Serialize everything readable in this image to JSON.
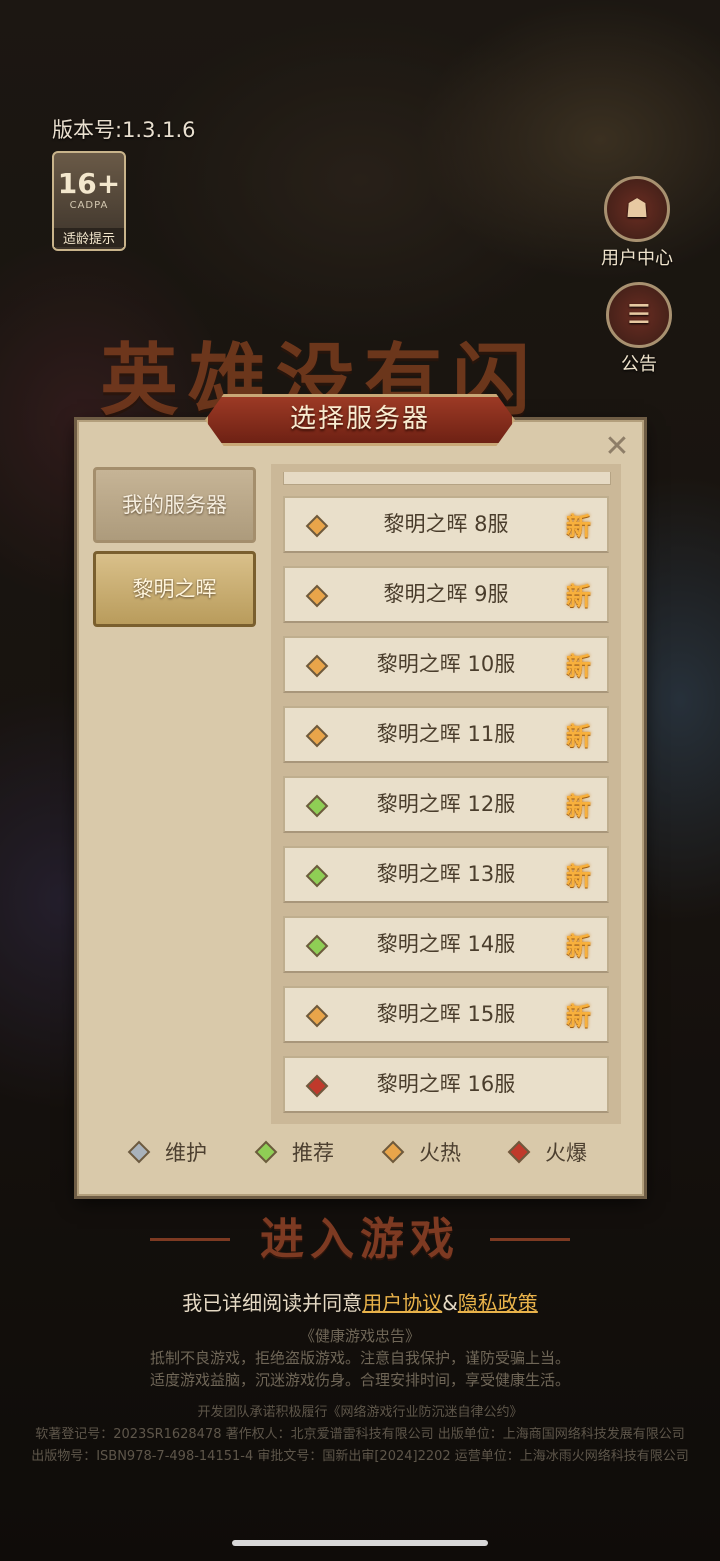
{
  "header": {
    "version_label": "版本号:1.3.1.6",
    "age_rating": {
      "badge": "16+",
      "org": "CADPA",
      "tip": "适龄提示"
    }
  },
  "side_buttons": {
    "user_center": "用户中心",
    "notice": "公告"
  },
  "game_logo_text": "英雄没有闪",
  "server_dialog": {
    "title": "选择服务器",
    "close_glyph": "✕",
    "tabs": [
      {
        "label": "我的服务器",
        "active": false
      },
      {
        "label": "黎明之晖",
        "active": true
      }
    ],
    "servers": [
      {
        "name": "黎明之晖 8服",
        "status": "hot",
        "new_badge": "新"
      },
      {
        "name": "黎明之晖 9服",
        "status": "hot",
        "new_badge": "新"
      },
      {
        "name": "黎明之晖 10服",
        "status": "hot",
        "new_badge": "新"
      },
      {
        "name": "黎明之晖 11服",
        "status": "hot",
        "new_badge": "新"
      },
      {
        "name": "黎明之晖 12服",
        "status": "recommend",
        "new_badge": "新"
      },
      {
        "name": "黎明之晖 13服",
        "status": "recommend",
        "new_badge": "新"
      },
      {
        "name": "黎明之晖 14服",
        "status": "recommend",
        "new_badge": "新"
      },
      {
        "name": "黎明之晖 15服",
        "status": "hot",
        "new_badge": "新"
      },
      {
        "name": "黎明之晖 16服",
        "status": "fire",
        "new_badge": ""
      }
    ],
    "legend": [
      {
        "key": "maintenance",
        "label": "维护"
      },
      {
        "key": "recommend",
        "label": "推荐"
      },
      {
        "key": "hot",
        "label": "火热"
      },
      {
        "key": "fire",
        "label": "火爆"
      }
    ]
  },
  "status_colors": {
    "maintenance": "#a9b2bb",
    "recommend": "#8fce55",
    "hot": "#e9a54a",
    "fire": "#c0392b"
  },
  "enter_game_label": "进入游戏",
  "agreement": {
    "prefix": "我已详细阅读并同意",
    "user_agreement": "用户协议",
    "amp": "&",
    "privacy_policy": "隐私政策"
  },
  "health_notice": {
    "title": "《健康游戏忠告》",
    "line1": "抵制不良游戏，拒绝盗版游戏。注意自我保护，谨防受骗上当。",
    "line2": "适度游戏益脑，沉迷游戏伤身。合理安排时间，享受健康生活。"
  },
  "legal": {
    "line1": "开发团队承诺积极履行《网络游戏行业防沉迷自律公约》",
    "line2": "软著登记号：2023SR1628478 著作权人：北京爱谱雷科技有限公司 出版单位：上海商国网络科技发展有限公司",
    "line3": "出版物号：ISBN978-7-498-14151-4 审批文号：国新出审[2024]2202 运营单位：上海冰雨火网络科技有限公司"
  }
}
